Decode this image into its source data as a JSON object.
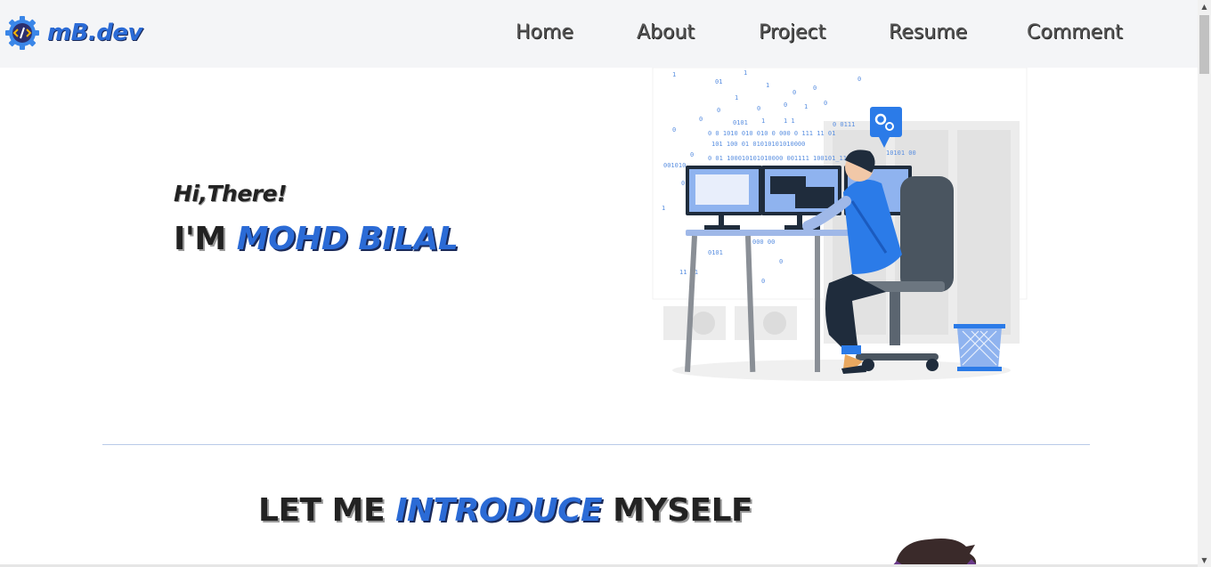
{
  "brand": {
    "name": "mB.dev",
    "icon": "code-gear-icon"
  },
  "nav": {
    "items": [
      {
        "label": "Home"
      },
      {
        "label": "About"
      },
      {
        "label": "Project"
      },
      {
        "label": "Resume"
      },
      {
        "label": "Comment"
      }
    ]
  },
  "hero": {
    "greeting": "Hi,There!",
    "prefix": "I'M",
    "name": "MOHD BILAL",
    "illustration": "developer-at-desk-illustration"
  },
  "intro": {
    "before": "LET ME",
    "accent": "INTRODUCE",
    "after": "MYSELF"
  },
  "colors": {
    "accent": "#2b6bd6",
    "navbar": "#f4f5f7",
    "text": "#222222"
  }
}
